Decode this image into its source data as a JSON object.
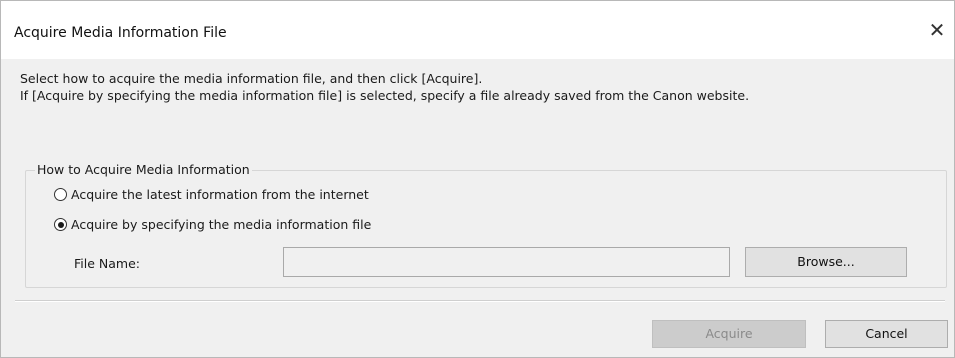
{
  "window": {
    "title": "Acquire Media Information File",
    "close_glyph": "✕"
  },
  "instructions": {
    "line1": "Select how to acquire the media information file, and then click [Acquire].",
    "line2": "If [Acquire by specifying the media information file] is selected, specify a file already saved from the Canon website."
  },
  "group": {
    "label": "How to Acquire Media Information",
    "options": [
      {
        "label": "Acquire the latest information from the internet",
        "selected": false
      },
      {
        "label": "Acquire by specifying the media information file",
        "selected": true
      }
    ],
    "file_name_label": "File Name:",
    "file_name_value": "",
    "browse_label": "Browse..."
  },
  "buttons": {
    "acquire_label": "Acquire",
    "acquire_enabled": false,
    "cancel_label": "Cancel"
  },
  "icons": {
    "close": "close-icon",
    "radio_unchecked": "radio-unchecked-icon",
    "radio_checked": "radio-checked-icon"
  }
}
